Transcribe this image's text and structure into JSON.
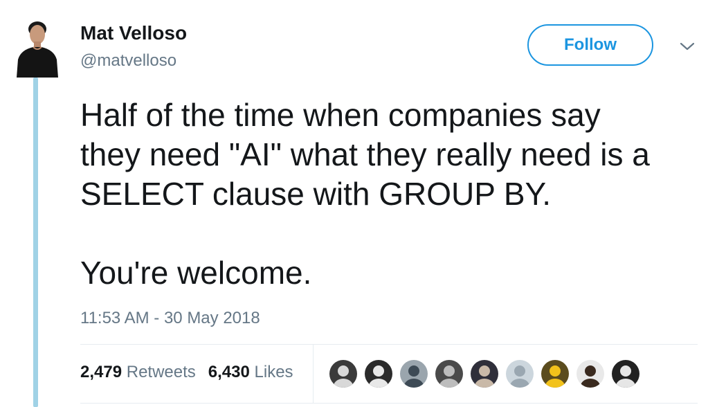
{
  "tweet": {
    "author_name": "Mat Velloso",
    "author_handle": "@matvelloso",
    "follow_label": "Follow",
    "text_paragraphs": [
      [
        "Half of the time when companies say",
        "they need \"AI\" what they really need is a",
        "SELECT clause with GROUP BY."
      ],
      [
        "You're welcome."
      ]
    ],
    "timestamp": "11:53 AM - 30 May 2018"
  },
  "stats": {
    "retweets_count": "2,479",
    "retweets_label": "Retweets",
    "likes_count": "6,430",
    "likes_label": "Likes"
  },
  "likers": [
    {
      "icon": "liker-avatar-1",
      "bg": "#3a3a3a",
      "fg": "#d8d8d8"
    },
    {
      "icon": "liker-avatar-2",
      "bg": "#2b2b2b",
      "fg": "#e8e8e8"
    },
    {
      "icon": "liker-avatar-3",
      "bg": "#9aa5ad",
      "fg": "#3d4a55"
    },
    {
      "icon": "liker-avatar-4",
      "bg": "#4a4a4a",
      "fg": "#bdbdbd"
    },
    {
      "icon": "liker-avatar-5",
      "bg": "#2f2f3a",
      "fg": "#c9b9a8"
    },
    {
      "icon": "liker-avatar-default",
      "bg": "#ccd6dd",
      "fg": "#9aa7b1"
    },
    {
      "icon": "liker-avatar-7",
      "bg": "#5b4c1e",
      "fg": "#f2c21b"
    },
    {
      "icon": "liker-avatar-8",
      "bg": "#e9e9e9",
      "fg": "#3a2a1f"
    },
    {
      "icon": "liker-avatar-9",
      "bg": "#222222",
      "fg": "#e6e6e6"
    }
  ],
  "colors": {
    "accent": "#1b95e0",
    "thread_line": "#a0d2e6",
    "secondary_text": "#657786",
    "primary_text": "#14171a"
  }
}
